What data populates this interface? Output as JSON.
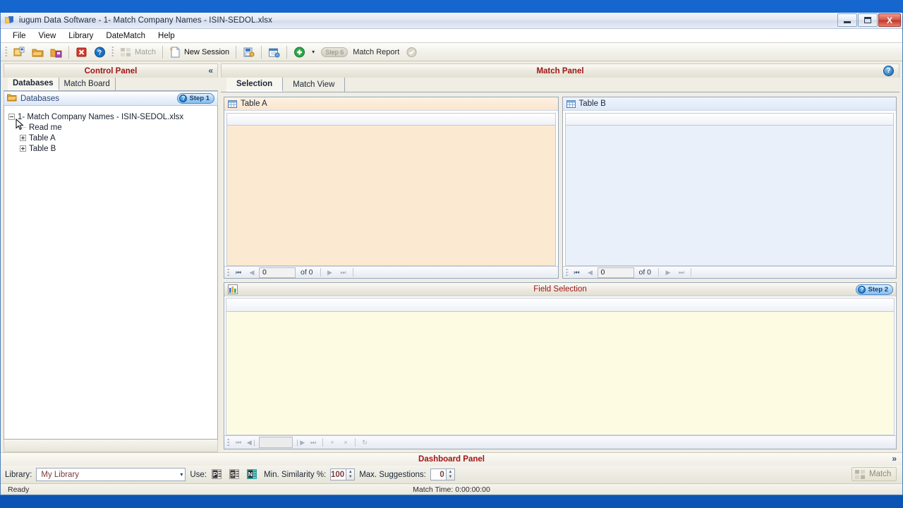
{
  "window": {
    "title": "iugum Data Software  - 1- Match Company Names - ISIN-SEDOL.xlsx",
    "minimize_label": "Minimize",
    "maximize_label": "Maximize",
    "close_label": "X"
  },
  "menu": {
    "items": [
      {
        "label": "File"
      },
      {
        "label": "View"
      },
      {
        "label": "Library"
      },
      {
        "label": "DateMatch"
      },
      {
        "label": "Help"
      }
    ]
  },
  "toolbar": {
    "new_database_label": "",
    "open_label": "",
    "save_label": "",
    "close_label": "",
    "help_label": "",
    "match_label": "Match",
    "new_session_label": "New Session",
    "save_session_label": "",
    "schedule_label": "",
    "add_label": "",
    "dropdown_label": "▾",
    "step6_chip": "Step 6",
    "match_report_label": "Match Report",
    "report_ok_label": ""
  },
  "control_panel": {
    "caption": "Control Panel",
    "collapse_label": "«",
    "tabs": [
      {
        "label": "Databases",
        "active": true
      },
      {
        "label": "Match Board",
        "active": false
      }
    ],
    "databases_header": "Databases",
    "step_badge": {
      "q": "?",
      "label": "Step 1"
    },
    "tree": [
      {
        "label": "1- Match Company Names - ISIN-SEDOL.xlsx",
        "level": 0,
        "toggle": "minus"
      },
      {
        "label": "Read me",
        "level": 1,
        "toggle": "dash"
      },
      {
        "label": "Table A",
        "level": 1,
        "toggle": "plus"
      },
      {
        "label": "Table B",
        "level": 1,
        "toggle": "plus"
      }
    ]
  },
  "match_panel": {
    "caption": "Match Panel",
    "help_label": "?",
    "tabs": [
      {
        "label": "Selection",
        "active": true
      },
      {
        "label": "Match View",
        "active": false
      }
    ],
    "table_a": {
      "title": "Table A",
      "icon": "grid-icon",
      "nav": {
        "first": "⏮",
        "prev": "◀",
        "record": "0",
        "of": "of 0",
        "next": "▶",
        "last": "⏭"
      }
    },
    "table_b": {
      "title": "Table B",
      "icon": "grid-icon",
      "nav": {
        "first": "⏮",
        "prev": "◀",
        "record": "0",
        "of": "of 0",
        "next": "▶",
        "last": "⏭"
      }
    },
    "field_selection": {
      "title": "Field Selection",
      "icon": "fields-icon",
      "step_badge": {
        "q": "?",
        "label": "Step 2"
      },
      "nav": {
        "first": "⏮",
        "prev": "◀❘",
        "record": "",
        "next": "❘▶",
        "last": "⏭",
        "add": "+",
        "delete": "×",
        "refresh": "↻"
      }
    }
  },
  "dashboard": {
    "caption": "Dashboard Panel",
    "expand_label": "»",
    "library_label": "Library:",
    "library_value": "My Library",
    "library_arrow": "▾",
    "use_label": "Use:",
    "use_buttons": [
      {
        "name": "phonetic-button",
        "glyph": "P"
      },
      {
        "name": "string-button",
        "glyph": "S"
      },
      {
        "name": "numeric-button",
        "glyph": "N"
      }
    ],
    "min_similarity_label": "Min. Similarity %:",
    "min_similarity_value": "100",
    "max_suggestions_label": "Max. Suggestions:",
    "max_suggestions_value": "0",
    "match_button_label": "Match"
  },
  "statusbar": {
    "ready": "Ready",
    "match_time": "Match Time: 0:00:00:00"
  },
  "colors": {
    "caption_red": "#a01515",
    "table_a_tint": "#fce9d2",
    "table_b_tint": "#e9f0fa",
    "field_selection_tint": "#fdfce3",
    "desktop_blue": "#0f5bbd"
  }
}
